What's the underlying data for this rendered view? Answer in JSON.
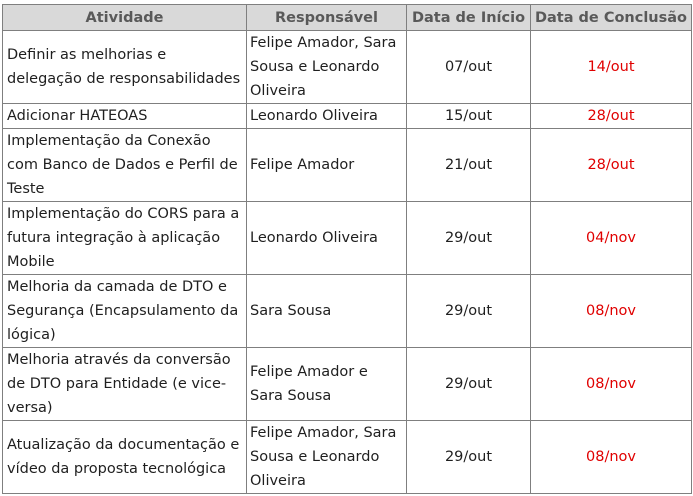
{
  "table": {
    "headers": {
      "activity": "Atividade",
      "owner": "Responsável",
      "start": "Data de Início",
      "end": "Data de Conclusão"
    },
    "rows": [
      {
        "activity": "Definir as melhorias e delegação de responsabilidades",
        "owner": "Felipe Amador, Sara Sousa e Leonardo Oliveira",
        "start": "07/out",
        "end": "14/out"
      },
      {
        "activity": "Adicionar HATEOAS",
        "owner": "Leonardo Oliveira",
        "start": "15/out",
        "end": "28/out"
      },
      {
        "activity": "Implementação da Conexão com Banco de Dados e Perfil de Teste",
        "owner": "Felipe Amador",
        "start": "21/out",
        "end": "28/out"
      },
      {
        "activity": "Implementação do CORS para a futura integração à aplicação Mobile",
        "owner": "Leonardo Oliveira",
        "start": "29/out",
        "end": "04/nov"
      },
      {
        "activity": "Melhoria da camada de DTO e Segurança (Encapsulamento da lógica)",
        "owner": "Sara Sousa",
        "start": "29/out",
        "end": "08/nov"
      },
      {
        "activity": "Melhoria através da conversão de DTO para Entidade (e vice-versa)",
        "owner": "Felipe Amador e Sara Sousa",
        "start": "29/out",
        "end": "08/nov"
      },
      {
        "activity": "Atualização da documentação e vídeo da proposta tecnológica",
        "owner": "Felipe Amador, Sara Sousa e Leonardo Oliveira",
        "start": "29/out",
        "end": "08/nov"
      }
    ],
    "colors": {
      "header_bg": "#d9d9d9",
      "header_text": "#595959",
      "end_date_text": "#e00000",
      "grid": "#7f7f7f"
    }
  }
}
